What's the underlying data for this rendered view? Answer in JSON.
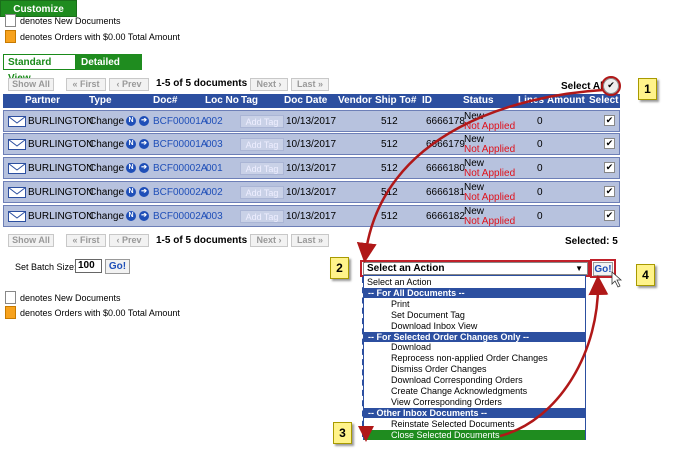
{
  "legend": {
    "new_docs": "denotes New Documents",
    "zero_orders": "denotes Orders with $0.00 Total Amount"
  },
  "views": {
    "standard": "Standard View",
    "detailed": "Detailed View",
    "customize": "Customize View"
  },
  "pagination": {
    "show_all": "Show All",
    "first": "« First",
    "prev": "‹ Prev",
    "range": "1-5 of 5 documents",
    "next": "Next ›",
    "last": "Last »",
    "select_all": "Select All",
    "selected": "Selected: 5"
  },
  "table": {
    "headers": [
      "Partner",
      "Type",
      "Doc#",
      "Loc No",
      "Tag",
      "Doc Date",
      "Vendor",
      "Ship To#",
      "ID",
      "Status",
      "Lines",
      "Amount",
      "Select"
    ],
    "rows": [
      {
        "partner": "BURLINGTON",
        "type": "Change",
        "doc": "BCF00001A",
        "loc": "002",
        "tag": "Add Tag",
        "date": "10/13/2017",
        "ship": "512",
        "id": "6666178",
        "status1": "New",
        "status2": "Not Applied",
        "lines": "0",
        "checked": "✔"
      },
      {
        "partner": "BURLINGTON",
        "type": "Change",
        "doc": "BCF00001A",
        "loc": "003",
        "tag": "Add Tag",
        "date": "10/13/2017",
        "ship": "512",
        "id": "6666179",
        "status1": "New",
        "status2": "Not Applied",
        "lines": "0",
        "checked": "✔"
      },
      {
        "partner": "BURLINGTON",
        "type": "Change",
        "doc": "BCF00002A",
        "loc": "001",
        "tag": "Add Tag",
        "date": "10/13/2017",
        "ship": "512",
        "id": "6666180",
        "status1": "New",
        "status2": "Not Applied",
        "lines": "0",
        "checked": "✔"
      },
      {
        "partner": "BURLINGTON",
        "type": "Change",
        "doc": "BCF00002A",
        "loc": "002",
        "tag": "Add Tag",
        "date": "10/13/2017",
        "ship": "512",
        "id": "6666181",
        "status1": "New",
        "status2": "Not Applied",
        "lines": "0",
        "checked": "✔"
      },
      {
        "partner": "BURLINGTON",
        "type": "Change",
        "doc": "BCF00002A",
        "loc": "003",
        "tag": "Add Tag",
        "date": "10/13/2017",
        "ship": "512",
        "id": "6666182",
        "status1": "New",
        "status2": "Not Applied",
        "lines": "0",
        "checked": "✔"
      }
    ]
  },
  "batch": {
    "label": "Set Batch Size:",
    "value": "100",
    "go": "Go!"
  },
  "actions": {
    "selected": "Select an Action",
    "arrow": "▼",
    "go": "Go!",
    "options": [
      {
        "kind": "first",
        "label": "Select an Action"
      },
      {
        "kind": "grp",
        "label": "-- For All Documents --"
      },
      {
        "kind": "item",
        "label": "Print"
      },
      {
        "kind": "item",
        "label": "Set Document Tag"
      },
      {
        "kind": "item",
        "label": "Download Inbox View"
      },
      {
        "kind": "grp",
        "label": "-- For Selected Order Changes Only --"
      },
      {
        "kind": "item",
        "label": "Download"
      },
      {
        "kind": "item",
        "label": "Reprocess non-applied Order Changes"
      },
      {
        "kind": "item",
        "label": "Dismiss Order Changes"
      },
      {
        "kind": "item",
        "label": "Download Corresponding Orders"
      },
      {
        "kind": "item",
        "label": "Create Change Acknowledgments"
      },
      {
        "kind": "item",
        "label": "View Corresponding Orders"
      },
      {
        "kind": "grp",
        "label": "-- Other Inbox Documents --"
      },
      {
        "kind": "item",
        "label": "Reinstate Selected Documents"
      },
      {
        "kind": "hl",
        "label": "Close Selected Documents"
      }
    ]
  },
  "callouts": [
    "1",
    "2",
    "3",
    "4"
  ],
  "colors": {
    "header_blue": "#2c4fa0",
    "row_blue": "#b7c2de",
    "green": "#1f8c1f",
    "red": "#e0101a",
    "callout_yellow": "#fff38a",
    "arrow_red": "#b01818"
  }
}
